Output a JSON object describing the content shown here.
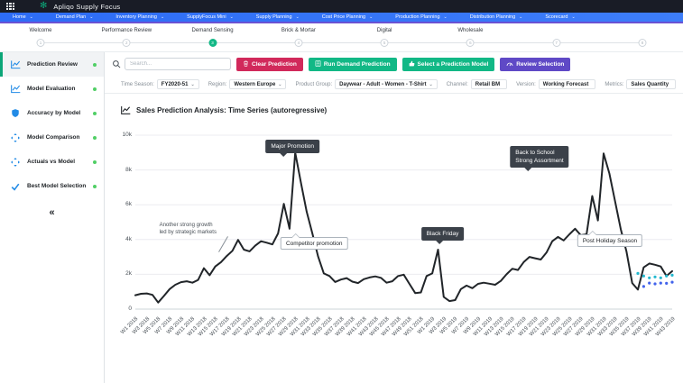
{
  "app": {
    "title": "Apliqo Supply Focus",
    "logo_glyph": "✻"
  },
  "menu": {
    "items": [
      {
        "label": "Home",
        "caret": "⌄"
      },
      {
        "label": "Demand Plan",
        "caret": "⌄"
      },
      {
        "label": "Inventory Planning",
        "caret": "⌄"
      },
      {
        "label": "SupplyFocus Mini",
        "caret": "⌄"
      },
      {
        "label": "Supply Planning",
        "caret": "⌄"
      },
      {
        "label": "Cost Price Planning",
        "caret": "⌄"
      },
      {
        "label": "Production Planning",
        "caret": "⌄"
      },
      {
        "label": "Distribution Planning",
        "caret": "⌄"
      },
      {
        "label": "Scorecard",
        "caret": "⌄"
      }
    ]
  },
  "stepper": {
    "collapse_glyph": "«",
    "steps": [
      {
        "num": "1",
        "label": "Welcome",
        "state": "done"
      },
      {
        "num": "2",
        "label": "Performance Review",
        "state": "done"
      },
      {
        "num": "3",
        "label": "Demand Sensing",
        "state": "active"
      },
      {
        "num": "4",
        "label": "Brick & Mortar",
        "state": "todo"
      },
      {
        "num": "5",
        "label": "Digital",
        "state": "todo"
      },
      {
        "num": "6",
        "label": "Wholesale",
        "state": "todo"
      },
      {
        "num": "7",
        "label": "",
        "state": "todo"
      },
      {
        "num": "8",
        "label": "",
        "state": "todo"
      }
    ]
  },
  "sidebar": {
    "collapse_glyph": "«",
    "items": [
      {
        "label": "Prediction Review",
        "icon": "line-chart-icon",
        "state": "active"
      },
      {
        "label": "Model Evaluation",
        "icon": "line-chart-icon",
        "state": ""
      },
      {
        "label": "Accuracy by Model",
        "icon": "shield-icon",
        "state": ""
      },
      {
        "label": "Model Comparison",
        "icon": "compare-icon",
        "state": ""
      },
      {
        "label": "Actuals vs Model",
        "icon": "compare-icon",
        "state": ""
      },
      {
        "label": "Best Model Selection",
        "icon": "check-icon",
        "state": ""
      }
    ],
    "status_dot_color": "#51cf66"
  },
  "toolbar": {
    "search_placeholder": "Search...",
    "buttons": [
      {
        "label": "Clear Prediction",
        "color": "#d1295b",
        "icon": "trash-icon"
      },
      {
        "label": "Run Demand Prediction",
        "color": "#12b886",
        "icon": "calculator-icon"
      },
      {
        "label": "Select a Prediction Model",
        "color": "#12b886",
        "icon": "thumbs-up-icon"
      },
      {
        "label": "Review Selection",
        "color": "#5f49c6",
        "icon": "gauge-icon"
      }
    ]
  },
  "filters": {
    "items": [
      {
        "label": "Time Season:",
        "value": "FY2020-51",
        "caret": "⌄"
      },
      {
        "label": "Region:",
        "value": "Western Europe",
        "caret": "⌄"
      },
      {
        "label": "Product Group:",
        "value": "Daywear - Adult - Women - T-Shirt",
        "caret": "⌄"
      },
      {
        "label": "Channel:",
        "value": "Retail BM",
        "caret": ""
      },
      {
        "label": "Version:",
        "value": "Working Forecast",
        "caret": ""
      },
      {
        "label": "Metrics:",
        "value": "Sales Quantity",
        "caret": ""
      }
    ]
  },
  "chart_data": {
    "type": "line",
    "title": "Sales Prediction Analysis: Time Series (autoregressive)",
    "ylim": [
      0,
      10000
    ],
    "grid": true,
    "line_color": "#212529",
    "yticks": [
      {
        "label": "0",
        "value": 0
      },
      {
        "label": "2k",
        "value": 2000
      },
      {
        "label": "4k",
        "value": 4000
      },
      {
        "label": "6k",
        "value": 6000
      },
      {
        "label": "8k",
        "value": 8000
      },
      {
        "label": "10k",
        "value": 10000
      }
    ],
    "x_tick_labels": [
      "W1 2018",
      "W3 2018",
      "W5 2018",
      "W7 2018",
      "W9 2018",
      "W11 2018",
      "W13 2018",
      "W15 2018",
      "W17 2018",
      "W19 2018",
      "W21 2018",
      "W23 2018",
      "W25 2018",
      "W27 2018",
      "W29 2018",
      "W31 2018",
      "W33 2018",
      "W35 2018",
      "W37 2018",
      "W39 2018",
      "W41 2018",
      "W43 2018",
      "W45 2018",
      "W47 2018",
      "W49 2018",
      "W51 2018",
      "W1 2019",
      "W3 2019",
      "W5 2019",
      "W7 2019",
      "W9 2019",
      "W11 2019",
      "W13 2019",
      "W15 2019",
      "W17 2019",
      "W19 2019",
      "W21 2019",
      "W23 2019",
      "W25 2019",
      "W27 2019",
      "W29 2019",
      "W31 2019",
      "W33 2019",
      "W35 2019",
      "W37 2019",
      "W39 2019",
      "W41 2019",
      "W43 2019"
    ],
    "series_name": "Sales Quantity",
    "values": [
      800,
      880,
      900,
      820,
      380,
      750,
      1150,
      1400,
      1550,
      1600,
      1520,
      1680,
      2350,
      1950,
      2450,
      2700,
      3050,
      3350,
      3980,
      3420,
      3320,
      3650,
      3900,
      3820,
      3720,
      4350,
      6050,
      4620,
      9000,
      7250,
      5600,
      4350,
      3020,
      2050,
      1900,
      1560,
      1700,
      1780,
      1580,
      1500,
      1720,
      1820,
      1880,
      1800,
      1520,
      1600,
      1900,
      1980,
      1450,
      920,
      960,
      1900,
      2050,
      3420,
      700,
      460,
      520,
      1150,
      1350,
      1200,
      1450,
      1520,
      1460,
      1400,
      1620,
      2000,
      2320,
      2250,
      2700,
      3000,
      2920,
      2850,
      3250,
      3900,
      4150,
      3950,
      4300,
      4620,
      4250,
      4300,
      6500,
      5100,
      8950,
      7800,
      6200,
      4600,
      3300,
      1500,
      1120,
      2400,
      2620,
      2550,
      2450,
      1900,
      2180
    ],
    "prediction_series": [
      {
        "name": "prediction-model-a",
        "color": "#22b8cf",
        "start_week": 88,
        "values": [
          2050,
          1900,
          1800,
          1850,
          1800,
          1900,
          1950
        ]
      },
      {
        "name": "prediction-model-b",
        "color": "#4263eb",
        "start_week": 89,
        "values": [
          1300,
          1500,
          1450,
          1500,
          1480,
          1550
        ]
      }
    ],
    "annotations": [
      {
        "label": "Another strong growth\nled by strategic markets",
        "style": "note",
        "week": 14,
        "value": 2450,
        "dx": -62,
        "dy": -50
      },
      {
        "label": "Major Promotion",
        "style": "dark",
        "week": 28,
        "value": 9000,
        "dx": -3,
        "dy": -14
      },
      {
        "label": "Competitor promotion",
        "style": "light",
        "week": 31,
        "value": 4350,
        "dx": 2,
        "dy": 4
      },
      {
        "label": "Black Friday",
        "style": "dark",
        "week": 53,
        "value": 3420,
        "dx": 5,
        "dy": -25
      },
      {
        "label": "Back to School\nStrong Assortment",
        "style": "dark",
        "week": 82,
        "value": 8950,
        "dx": -71,
        "dy": -8
      },
      {
        "label": "Post Holiday Season",
        "style": "light",
        "week": 85,
        "value": 4600,
        "dx": -12,
        "dy": 6
      }
    ]
  }
}
